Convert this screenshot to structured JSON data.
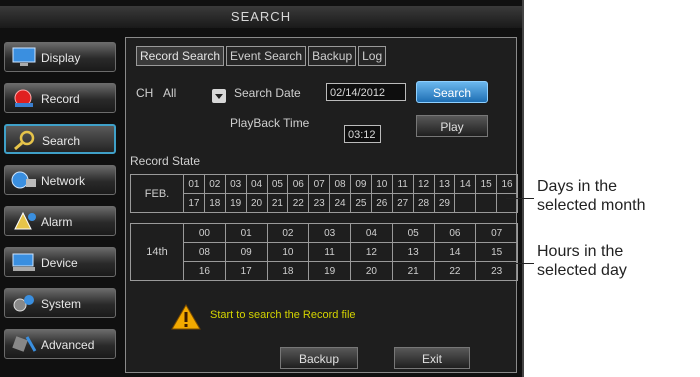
{
  "title": "SEARCH",
  "sidebar": {
    "items": [
      {
        "label": "Display",
        "icon": "monitor-icon"
      },
      {
        "label": "Record",
        "icon": "record-icon"
      },
      {
        "label": "Search",
        "icon": "magnifier-icon"
      },
      {
        "label": "Network",
        "icon": "network-icon"
      },
      {
        "label": "Alarm",
        "icon": "alarm-icon"
      },
      {
        "label": "Device",
        "icon": "device-icon"
      },
      {
        "label": "System",
        "icon": "system-icon"
      },
      {
        "label": "Advanced",
        "icon": "advanced-icon"
      }
    ],
    "active": "Search"
  },
  "tabs": [
    "Record Search",
    "Event Search",
    "Backup",
    "Log"
  ],
  "active_tab": "Record Search",
  "form": {
    "ch_label": "CH",
    "ch_value": "All",
    "search_date_label": "Search Date",
    "search_date_value": "02/14/2012",
    "search_button": "Search",
    "playback_label": "PlayBack Time",
    "playback_value": "03:12",
    "play_button": "Play"
  },
  "record_state": {
    "label": "Record State",
    "month_label": "FEB.",
    "days_row1": [
      "01",
      "02",
      "03",
      "04",
      "05",
      "06",
      "07",
      "08",
      "09",
      "10",
      "11",
      "12",
      "13",
      "14",
      "15",
      "16"
    ],
    "days_row2": [
      "17",
      "18",
      "19",
      "20",
      "21",
      "22",
      "23",
      "24",
      "25",
      "26",
      "27",
      "28",
      "29",
      "",
      "",
      ""
    ],
    "day_label": "14th",
    "hours": [
      [
        "00",
        "01",
        "02",
        "03",
        "04",
        "05",
        "06",
        "07"
      ],
      [
        "08",
        "09",
        "10",
        "11",
        "12",
        "13",
        "14",
        "15"
      ],
      [
        "16",
        "17",
        "18",
        "19",
        "20",
        "21",
        "22",
        "23"
      ]
    ]
  },
  "status_message": "Start to search the Record file",
  "bottom_buttons": {
    "backup": "Backup",
    "exit": "Exit"
  },
  "annotations": {
    "days": "Days in the selected month",
    "days_line1": "Days in the",
    "days_line2": "selected month",
    "hours_line1": "Hours in the",
    "hours_line2": "selected day"
  },
  "colors": {
    "accent": "#3fa0c8",
    "search_button": "#2f86cf",
    "warning_text": "#d4d400"
  }
}
